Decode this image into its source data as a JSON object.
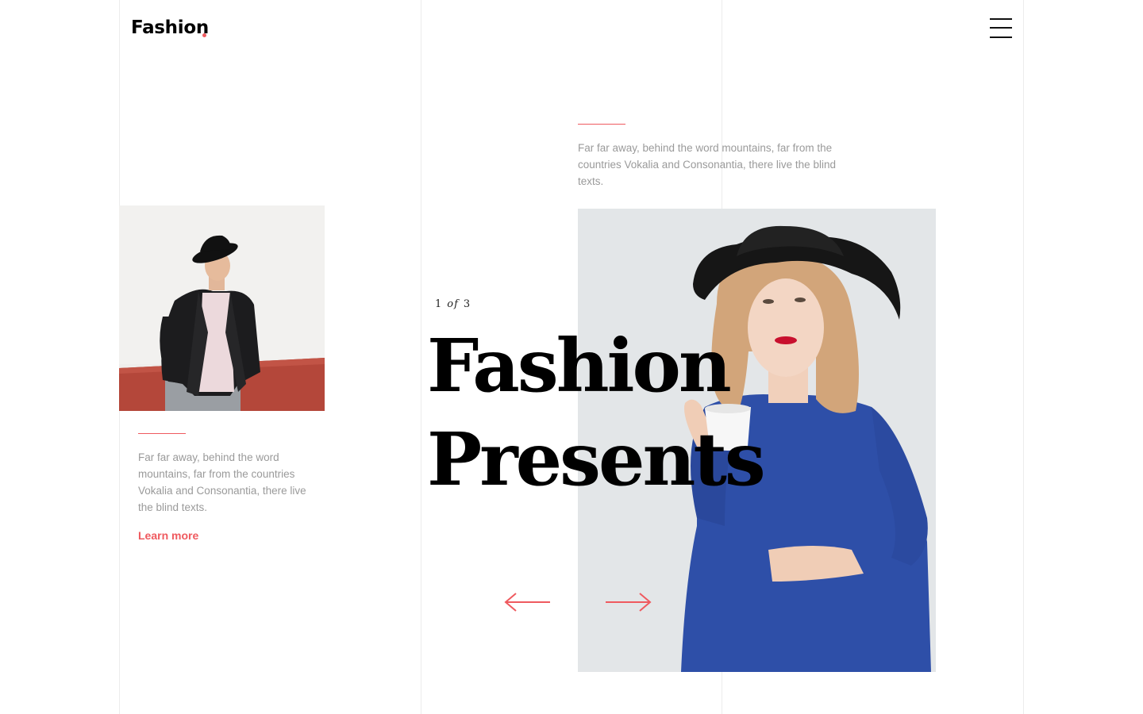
{
  "colors": {
    "accent": "#ef5a5f",
    "text": "#000000",
    "muted": "#9a9a9a"
  },
  "header": {
    "logo": "Fashion",
    "menu_icon": "hamburger-menu-icon"
  },
  "hero": {
    "intro_text": "Far far away, behind the word mountains, far from the countries Vokalia and Consonantia, there live the blind texts.",
    "counter": {
      "current": "1",
      "of": "of",
      "total": "3"
    },
    "title_line1": "Fashion",
    "title_line2": "Presents",
    "prev_icon": "arrow-left-icon",
    "next_icon": "arrow-right-icon"
  },
  "side_card": {
    "text": "Far far away, behind the word mountains, far from the countries Vokalia and Consonantia, there live the blind texts.",
    "link": "Learn more"
  }
}
